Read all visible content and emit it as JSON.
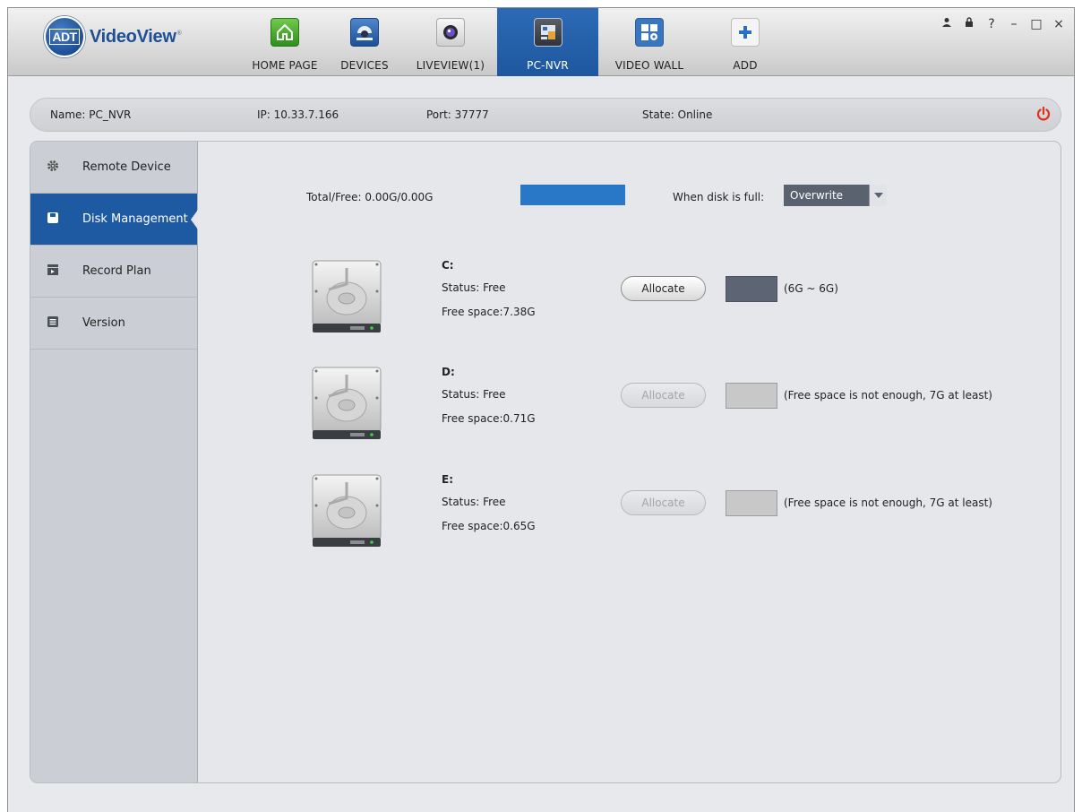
{
  "app": {
    "logo_badge": "ADT",
    "logo_name": "VideoView"
  },
  "tabs": [
    {
      "label": "HOME PAGE",
      "icon": "home-icon"
    },
    {
      "label": "DEVICES",
      "icon": "camera-dome-icon"
    },
    {
      "label": "LIVEVIEW(1)",
      "icon": "lens-icon"
    },
    {
      "label": "PC-NVR",
      "icon": "pc-nvr-icon",
      "active": true
    },
    {
      "label": "VIDEO WALL",
      "icon": "video-wall-icon"
    },
    {
      "label": "ADD",
      "icon": "plus-icon"
    }
  ],
  "window_controls": [
    "user-icon",
    "lock-icon",
    "help-icon",
    "minimize-icon",
    "maximize-icon",
    "close-icon"
  ],
  "window_glyphs": {
    "help": "?",
    "minimize": "–",
    "maximize": "□",
    "close": "×"
  },
  "device": {
    "name": "Name:  PC_NVR",
    "ip": "IP:  10.33.7.166",
    "port": "Port:    37777",
    "state": "State:  Online"
  },
  "sidebar": [
    {
      "label": "Remote Device",
      "icon": "gear-icon"
    },
    {
      "label": "Disk Management",
      "icon": "disk-save-icon",
      "active": true
    },
    {
      "label": "Record Plan",
      "icon": "clapper-icon"
    },
    {
      "label": "Version",
      "icon": "list-icon"
    }
  ],
  "storage": {
    "total_free": "Total/Free: 0.00G/0.00G",
    "when_full_label": "When disk is full:",
    "when_full_value": "Overwrite"
  },
  "disks": [
    {
      "name": "C:",
      "status": "Status: Free",
      "free": "Free space:7.38G",
      "allocate": "Allocate",
      "enabled": true,
      "note": "(6G ~ 6G)"
    },
    {
      "name": "D:",
      "status": "Status: Free",
      "free": "Free space:0.71G",
      "allocate": "Allocate",
      "enabled": false,
      "note": "(Free space is not enough, 7G at least)"
    },
    {
      "name": "E:",
      "status": "Status: Free",
      "free": "Free space:0.65G",
      "allocate": "Allocate",
      "enabled": false,
      "note": "(Free space is not enough, 7G at least)"
    }
  ],
  "colors": {
    "accent": "#1e5aa2",
    "bar": "#2978c7",
    "power": "#e0301e"
  }
}
